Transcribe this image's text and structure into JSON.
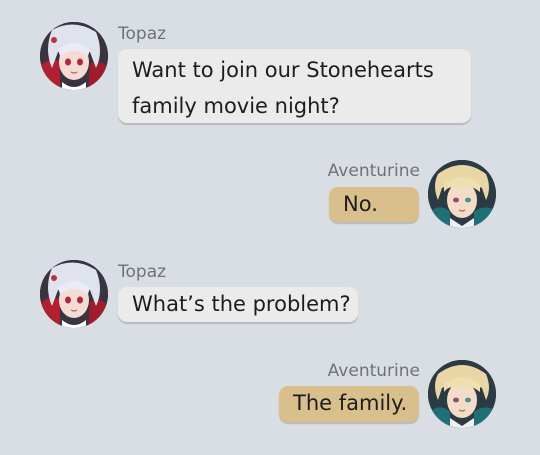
{
  "messages": [
    {
      "sender": "Topaz",
      "text": [
        "Want to join our Stonehearts",
        "family movie night?"
      ],
      "side": "left",
      "avatar_icon": "topaz-avatar-icon"
    },
    {
      "sender": "Aventurine",
      "text": [
        "No."
      ],
      "side": "right",
      "avatar_icon": "aventurine-avatar-icon"
    },
    {
      "sender": "Topaz",
      "text": [
        "What’s the problem?"
      ],
      "side": "left",
      "avatar_icon": "topaz-avatar-icon"
    },
    {
      "sender": "Aventurine",
      "text": [
        "The family."
      ],
      "side": "right",
      "avatar_icon": "aventurine-avatar-icon"
    }
  ],
  "colors": {
    "background": "#d9dee4",
    "left_bubble": "#ebebeb",
    "right_bubble": "#d9bf8c",
    "name_text": "#6f7278"
  }
}
